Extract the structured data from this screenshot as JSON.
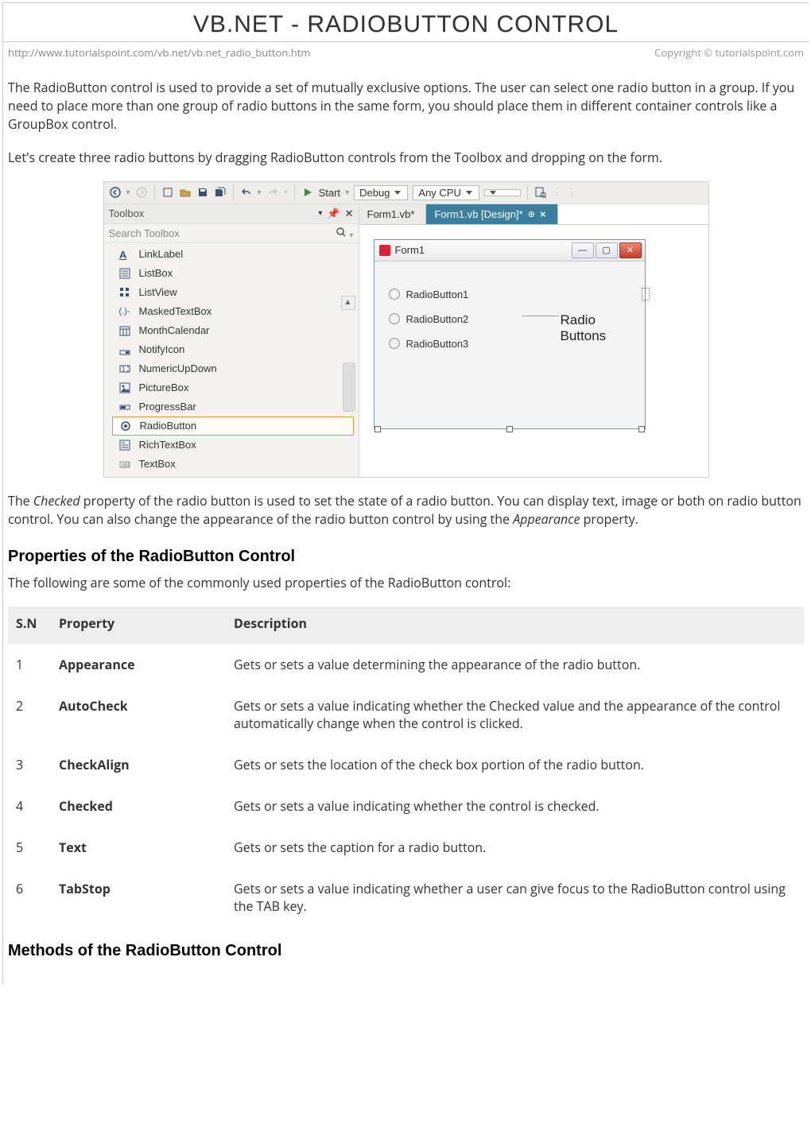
{
  "title": "VB.NET - RADIOBUTTON CONTROL",
  "url": "http://www.tutorialspoint.com/vb.net/vb.net_radio_button.htm",
  "copyright": "Copyright © tutorialspoint.com",
  "intro_p1": "The RadioButton control is used to provide a set of mutually exclusive options. The user can select one radio button in a group. If you need to place more than one group of radio buttons in the same form, you should place them in different container controls like a GroupBox control.",
  "intro_p2": "Let's create three radio buttons by dragging RadioButton controls from the Toolbox and dropping on the form.",
  "ide": {
    "start_label": "Start",
    "debug_label": "Debug",
    "cpu_label": "Any CPU",
    "toolbox_title": "Toolbox",
    "search_placeholder": "Search Toolbox",
    "items": [
      {
        "label": "LinkLabel"
      },
      {
        "label": "ListBox"
      },
      {
        "label": "ListView"
      },
      {
        "label": "MaskedTextBox"
      },
      {
        "label": "MonthCalendar"
      },
      {
        "label": "NotifyIcon"
      },
      {
        "label": "NumericUpDown"
      },
      {
        "label": "PictureBox"
      },
      {
        "label": "ProgressBar"
      },
      {
        "label": "RadioButton"
      },
      {
        "label": "RichTextBox"
      },
      {
        "label": "TextBox"
      }
    ],
    "tabs": {
      "inactive": "Form1.vb*",
      "active": "Form1.vb [Design]*"
    },
    "form": {
      "title": "Form1",
      "radios": [
        "RadioButton1",
        "RadioButton2",
        "RadioButton3"
      ],
      "callout": "Radio Buttons"
    }
  },
  "after_img": {
    "pre": "The ",
    "kw1": "Checked",
    "mid1": " property of the radio button is used to set the state of a radio button. You can display text, image or both on radio button control. You can also change the appearance of the radio button control by using the ",
    "kw2": "Appearance",
    "post": " property."
  },
  "sections": {
    "props_title": "Properties of the RadioButton Control",
    "props_intro": "The following are some of the commonly used properties of the RadioButton control:",
    "methods_title": "Methods of the RadioButton Control"
  },
  "props_table": {
    "headers": {
      "sn": "S.N",
      "prop": "Property",
      "desc": "Description"
    },
    "rows": [
      {
        "n": "1",
        "p": "Appearance",
        "d": "Gets or sets a value determining the appearance of the radio button."
      },
      {
        "n": "2",
        "p": "AutoCheck",
        "d": "Gets or sets a value indicating whether the Checked value and the appearance of the control automatically change when the control is clicked."
      },
      {
        "n": "3",
        "p": "CheckAlign",
        "d": "Gets or sets the location of the check box portion of the radio button."
      },
      {
        "n": "4",
        "p": "Checked",
        "d": "Gets or sets a value indicating whether the control is checked."
      },
      {
        "n": "5",
        "p": "Text",
        "d": "Gets or sets the caption for a radio button."
      },
      {
        "n": "6",
        "p": "TabStop",
        "d": "Gets or sets a value indicating whether a user can give focus to the RadioButton control using the TAB key."
      }
    ]
  }
}
